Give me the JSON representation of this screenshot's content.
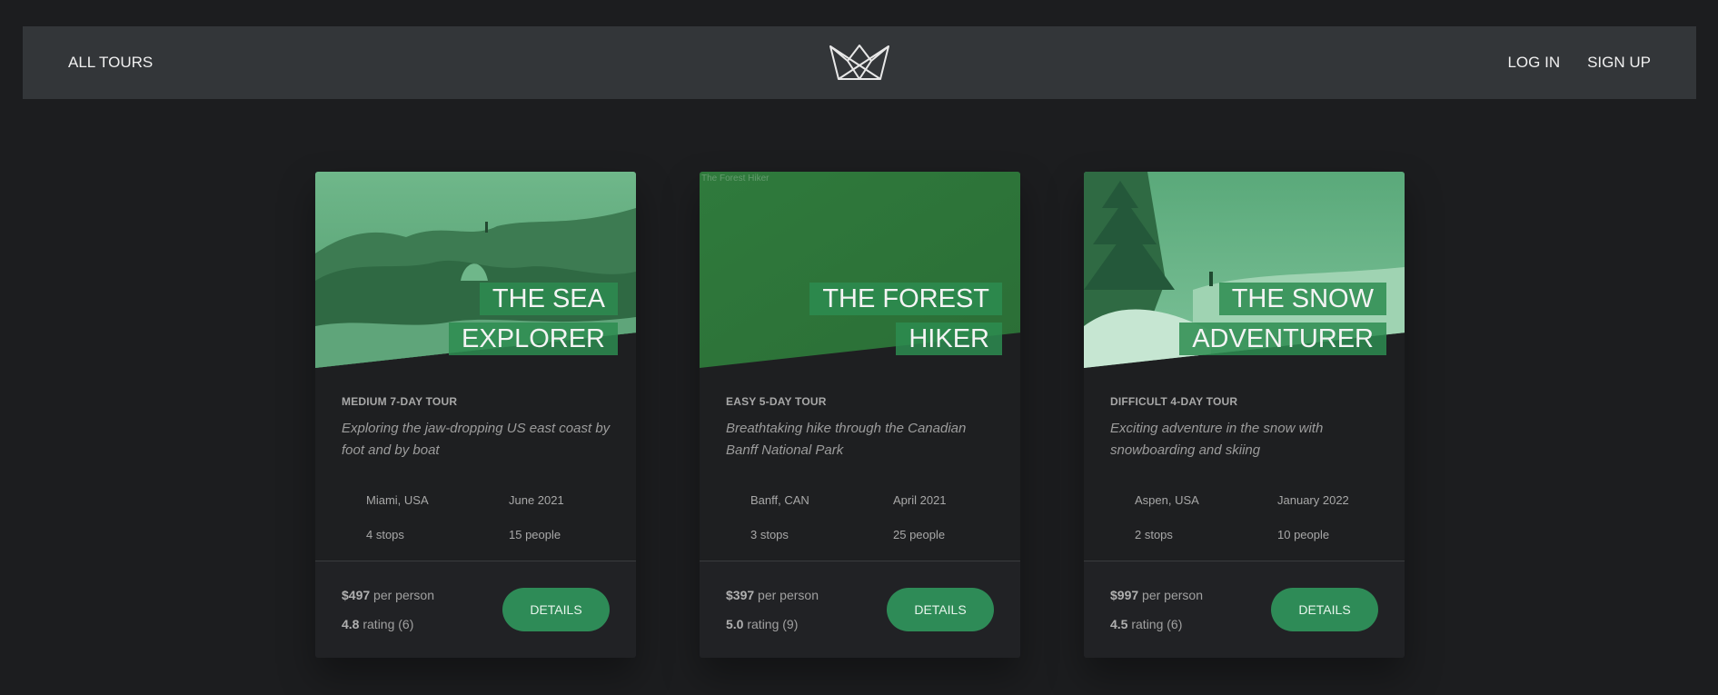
{
  "header": {
    "all_tours": "ALL TOURS",
    "login": "LOG IN",
    "signup": "SIGN UP",
    "logo_icon": "crown-logo-icon"
  },
  "cards": [
    {
      "title_line1": "THE SEA",
      "title_line2": "EXPLORER",
      "subheading": "MEDIUM 7-DAY TOUR",
      "description": "Exploring the jaw-dropping US east coast by foot and by boat",
      "location": "Miami, USA",
      "date": "June 2021",
      "stops": "4 stops",
      "people": "15 people",
      "price_value": "$497",
      "price_suffix": "per person",
      "rating_value": "4.8",
      "rating_suffix": "rating (6)",
      "button": "DETAILS"
    },
    {
      "title_line1": "THE FOREST",
      "title_line2": "HIKER",
      "image_alt": "The Forest Hiker",
      "subheading": "EASY 5-DAY TOUR",
      "description": "Breathtaking hike through the Canadian Banff National Park",
      "location": "Banff, CAN",
      "date": "April 2021",
      "stops": "3 stops",
      "people": "25 people",
      "price_value": "$397",
      "price_suffix": "per person",
      "rating_value": "5.0",
      "rating_suffix": "rating (9)",
      "button": "DETAILS"
    },
    {
      "title_line1": "THE SNOW",
      "title_line2": "ADVENTURER",
      "subheading": "DIFFICULT 4-DAY TOUR",
      "description": "Exciting adventure in the snow with snowboarding and skiing",
      "location": "Aspen, USA",
      "date": "January 2022",
      "stops": "2 stops",
      "people": "10 people",
      "price_value": "$997",
      "price_suffix": "per person",
      "rating_value": "4.5",
      "rating_suffix": "rating (6)",
      "button": "DETAILS"
    }
  ],
  "colors": {
    "accent": "#2e8b57",
    "background": "#1c1d1f",
    "header": "#333639"
  }
}
